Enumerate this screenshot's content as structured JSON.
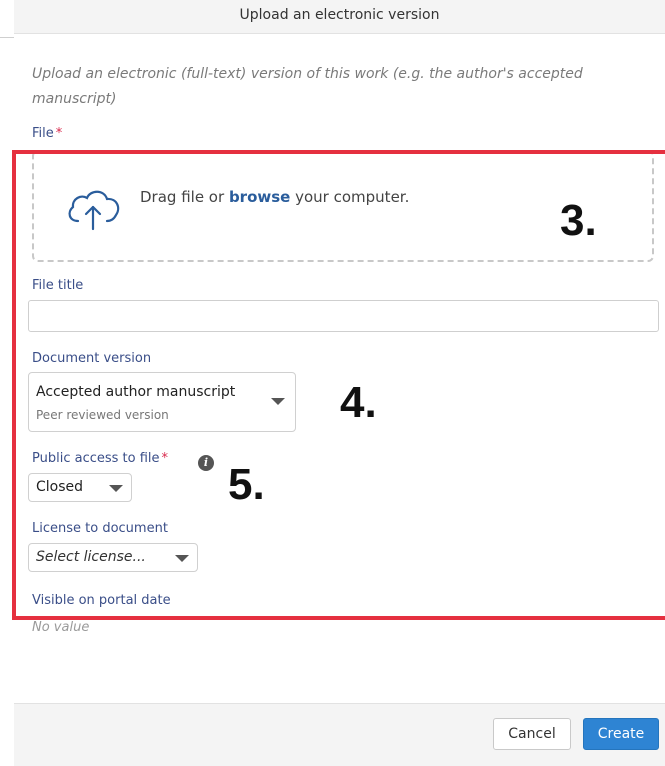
{
  "dialog": {
    "title": "Upload an electronic version",
    "intro": "Upload an electronic (full-text) version of this work (e.g. the author's accepted manuscript)"
  },
  "file": {
    "label": "File",
    "required_mark": "*",
    "dropzone_prefix": "Drag file or",
    "dropzone_link": "browse",
    "dropzone_suffix": "your computer."
  },
  "file_title": {
    "label": "File title",
    "value": ""
  },
  "document_version": {
    "label": "Document version",
    "selected": "Accepted author manuscript",
    "sub": "Peer reviewed version"
  },
  "public_access": {
    "label": "Public access to file",
    "required_mark": "*",
    "info_glyph": "i",
    "selected": "Closed"
  },
  "license": {
    "label": "License to document",
    "placeholder": "Select license..."
  },
  "visible_date": {
    "label": "Visible on portal date",
    "value": "No value"
  },
  "annotations": [
    "3.",
    "4.",
    "5."
  ],
  "footer": {
    "cancel": "Cancel",
    "create": "Create"
  },
  "colors": {
    "accent": "#2e84d3",
    "label": "#3a4e88",
    "required": "#d8284b",
    "highlight_box": "#e5303f"
  },
  "icons": {
    "upload": "cloud-upload-icon",
    "info": "info-icon",
    "caret": "chevron-down-icon"
  }
}
